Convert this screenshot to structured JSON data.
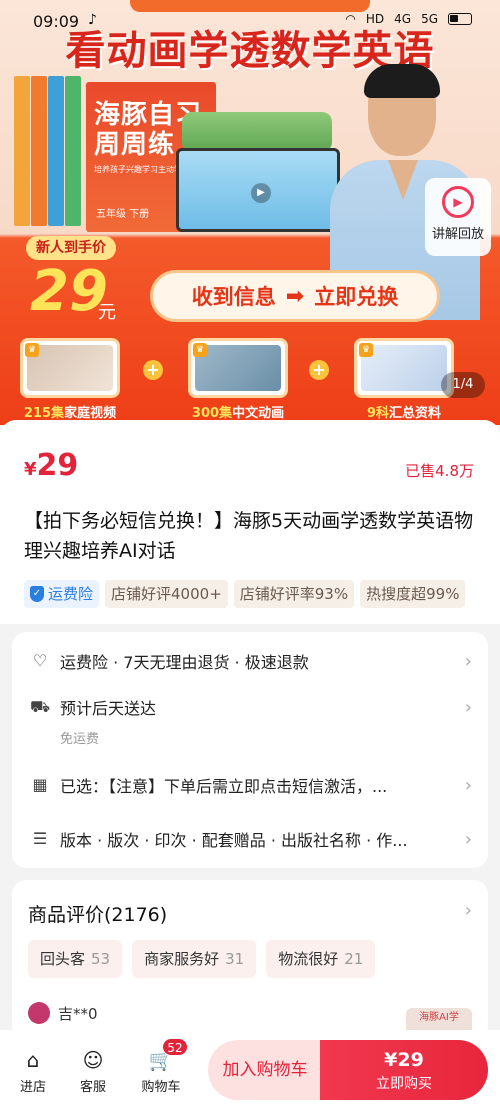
{
  "status_bar": {
    "time": "09:09",
    "app_icon": "tiktok-icon",
    "indicators": [
      "wifi-icon",
      "HD",
      "4G",
      "5G"
    ],
    "battery": "battery-icon"
  },
  "hero": {
    "headline": "看动画学透数学英语",
    "book_title": "海豚自习周周练",
    "book_subtitle": "培养孩子兴趣学习主动学",
    "book_grade": "五年级 下册",
    "replay_label": "讲解回放",
    "newcomer_tag": "新人到手价",
    "newcomer_price": "29",
    "newcomer_unit": "元",
    "exchange_left": "收到信息",
    "exchange_right": "立即兑换",
    "features": [
      {
        "count": "215集",
        "label": "家庭视频"
      },
      {
        "count": "300集",
        "label": "中文动画"
      },
      {
        "count": "9科",
        "label": "汇总资料"
      }
    ],
    "pager": "1/4"
  },
  "product": {
    "currency": "¥",
    "price": "29",
    "sold": "已售4.8万",
    "title": "【拍下务必短信兑换！】海豚5天动画学透数学英语物理兴趣培养AI对话",
    "tags": [
      "运费险",
      "店铺好评4000+",
      "店铺好评率93%",
      "热搜度超99%"
    ]
  },
  "services": {
    "row1": "运费险 · 7天无理由退货 · 极速退款",
    "row2": "预计后天送达",
    "row2_sub": "免运费",
    "row3": "已选：【注意】下单后需立即点击短信激活，...",
    "row4": "版本 · 版次 · 印次 · 配套赠品 · 出版社名称 · 作..."
  },
  "reviews": {
    "title": "商品评价(2176)",
    "tags": [
      {
        "label": "回头客",
        "count": "53"
      },
      {
        "label": "商家服务好",
        "count": "31"
      },
      {
        "label": "物流很好",
        "count": "21"
      }
    ],
    "reviewer": "吉**0",
    "thumb_text": "海豚AI学"
  },
  "bottom_bar": {
    "shop": "进店",
    "service": "客服",
    "cart": "购物车",
    "cart_count": "52",
    "add_to_cart": "加入购物车",
    "buy_price": "¥29",
    "buy_now": "立即购买"
  }
}
